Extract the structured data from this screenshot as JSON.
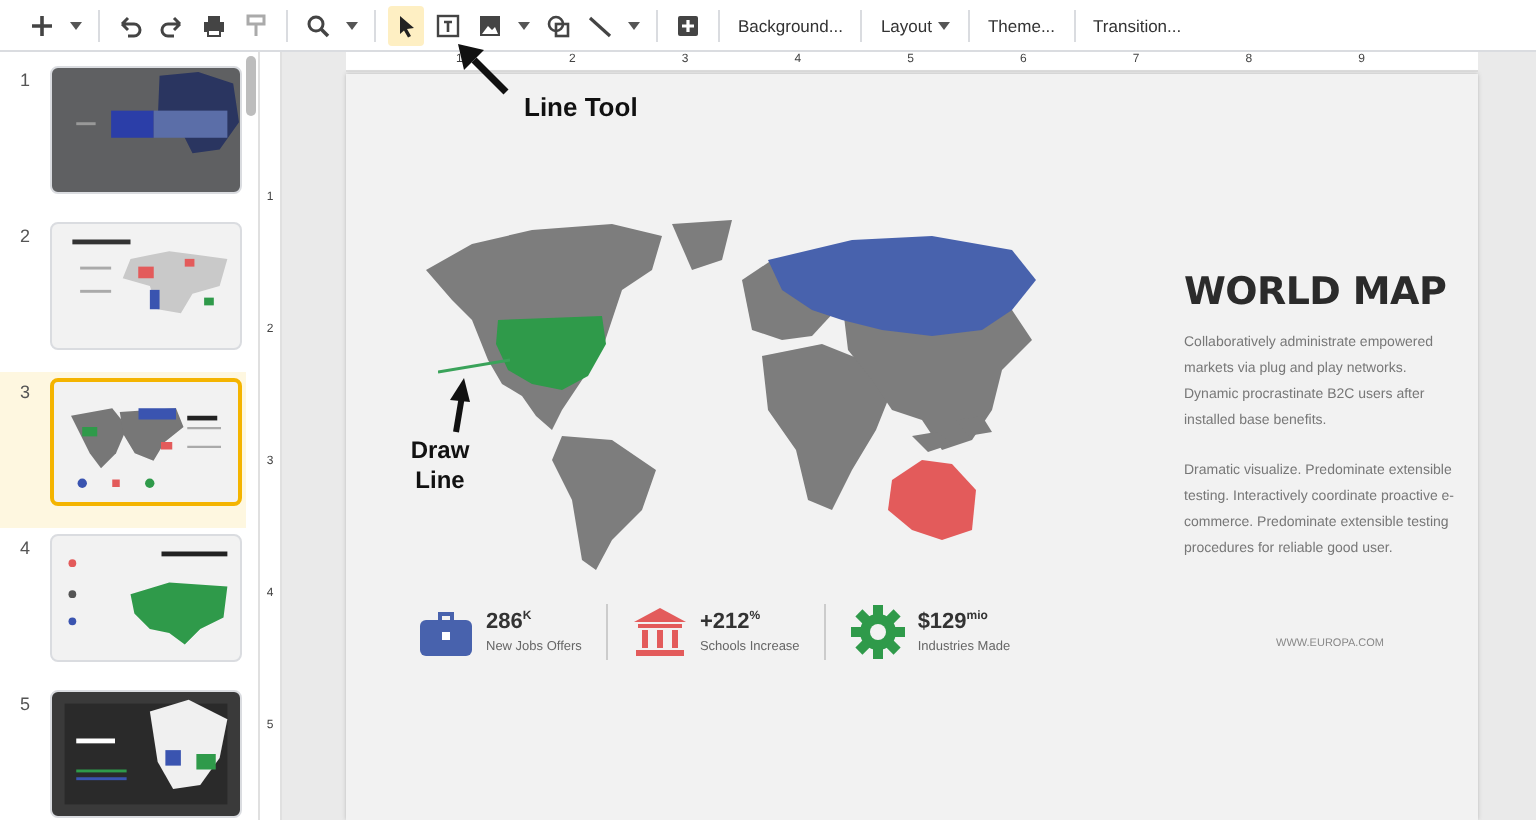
{
  "toolbar": {
    "tools": [
      {
        "kind": "add",
        "selected": false
      },
      {
        "kind": "undo",
        "selected": false
      },
      {
        "kind": "redo",
        "selected": false
      },
      {
        "kind": "print",
        "selected": false
      },
      {
        "kind": "paint",
        "selected": false
      },
      {
        "kind": "zoom",
        "selected": false
      },
      {
        "kind": "select",
        "selected": true
      },
      {
        "kind": "textbox",
        "selected": false
      },
      {
        "kind": "image",
        "selected": false
      },
      {
        "kind": "shape",
        "selected": false
      },
      {
        "kind": "line",
        "selected": false
      },
      {
        "kind": "comment",
        "selected": false
      }
    ],
    "menus": [
      {
        "label": "Background...",
        "dropdown": false
      },
      {
        "label": "Layout",
        "dropdown": true
      },
      {
        "label": "Theme...",
        "dropdown": false
      },
      {
        "label": "Transition...",
        "dropdown": false
      }
    ]
  },
  "ruler": {
    "horizontal": [
      "1",
      "2",
      "3",
      "4",
      "5",
      "6",
      "7",
      "8",
      "9"
    ],
    "vertical": [
      "1",
      "2",
      "3",
      "4",
      "5"
    ]
  },
  "slides": [
    {
      "number": "1",
      "kind": "cover",
      "selected": false
    },
    {
      "number": "2",
      "kind": "pins",
      "selected": false
    },
    {
      "number": "3",
      "kind": "world",
      "selected": true
    },
    {
      "number": "4",
      "kind": "green",
      "selected": false
    },
    {
      "number": "5",
      "kind": "dark",
      "selected": false
    }
  ],
  "slide": {
    "title": "WORLD MAP",
    "paragraphs": [
      "Collaboratively administrate empowered markets via plug and play networks. Dynamic procrastinate B2C users after installed base benefits.",
      "Dramatic visualize. Predominate extensible testing. Interactively coordinate proactive e-commerce. Predominate extensible testing procedures for reliable good user."
    ],
    "stats": [
      {
        "kind": "briefcase",
        "color": "#4862ad",
        "value": "286$^{K}$",
        "label": "New Jobs Offers"
      },
      {
        "kind": "bank",
        "color": "#e35b5b",
        "value": "+212$^{%}$",
        "label": "Schools Increase"
      },
      {
        "kind": "gear",
        "color": "#2f9a4a",
        "value": "$129$^{mio}$",
        "label": "Industries Made"
      }
    ],
    "website": "WWW.EUROPA.COM"
  },
  "annotations": [
    {
      "kind": "toolbar",
      "text": "Line Tool"
    },
    {
      "kind": "line",
      "text": "Draw Line"
    }
  ]
}
